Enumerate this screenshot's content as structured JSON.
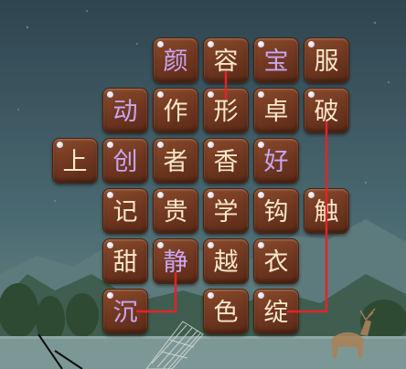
{
  "colors": {
    "purple_text": "#c8a6f2",
    "cream_text": "#f8e7c8",
    "link_line": "#e0242a",
    "tile_fill": "#6e3620"
  },
  "tiles": [
    {
      "id": "t-yan",
      "char": "颜",
      "row": 0,
      "col": 2,
      "color": "purple_text"
    },
    {
      "id": "t-rong",
      "char": "容",
      "row": 0,
      "col": 3,
      "color": "cream_text"
    },
    {
      "id": "t-bao",
      "char": "宝",
      "row": 0,
      "col": 4,
      "color": "purple_text"
    },
    {
      "id": "t-fu",
      "char": "服",
      "row": 0,
      "col": 5,
      "color": "cream_text"
    },
    {
      "id": "t-dong",
      "char": "动",
      "row": 1,
      "col": 1,
      "color": "purple_text"
    },
    {
      "id": "t-zuo",
      "char": "作",
      "row": 1,
      "col": 2,
      "color": "cream_text"
    },
    {
      "id": "t-xing",
      "char": "形",
      "row": 1,
      "col": 3,
      "color": "cream_text"
    },
    {
      "id": "t-zhuo",
      "char": "卓",
      "row": 1,
      "col": 4,
      "color": "cream_text"
    },
    {
      "id": "t-po",
      "char": "破",
      "row": 1,
      "col": 5,
      "color": "cream_text"
    },
    {
      "id": "t-shang",
      "char": "上",
      "row": 2,
      "col": 0,
      "color": "cream_text"
    },
    {
      "id": "t-chuang",
      "char": "创",
      "row": 2,
      "col": 1,
      "color": "purple_text"
    },
    {
      "id": "t-zhe",
      "char": "者",
      "row": 2,
      "col": 2,
      "color": "cream_text"
    },
    {
      "id": "t-xiang",
      "char": "香",
      "row": 2,
      "col": 3,
      "color": "cream_text"
    },
    {
      "id": "t-hao",
      "char": "好",
      "row": 2,
      "col": 4,
      "color": "purple_text"
    },
    {
      "id": "t-ji",
      "char": "记",
      "row": 3,
      "col": 1,
      "color": "cream_text"
    },
    {
      "id": "t-gui",
      "char": "贵",
      "row": 3,
      "col": 2,
      "color": "cream_text"
    },
    {
      "id": "t-xue",
      "char": "学",
      "row": 3,
      "col": 3,
      "color": "cream_text"
    },
    {
      "id": "t-gou",
      "char": "钩",
      "row": 3,
      "col": 4,
      "color": "cream_text"
    },
    {
      "id": "t-chu",
      "char": "触",
      "row": 3,
      "col": 5,
      "color": "cream_text"
    },
    {
      "id": "t-tian",
      "char": "甜",
      "row": 4,
      "col": 1,
      "color": "cream_text"
    },
    {
      "id": "t-jing",
      "char": "静",
      "row": 4,
      "col": 2,
      "color": "purple_text"
    },
    {
      "id": "t-yue",
      "char": "越",
      "row": 4,
      "col": 3,
      "color": "cream_text"
    },
    {
      "id": "t-yi",
      "char": "衣",
      "row": 4,
      "col": 4,
      "color": "cream_text"
    },
    {
      "id": "t-chen",
      "char": "沉",
      "row": 5,
      "col": 1,
      "color": "purple_text"
    },
    {
      "id": "t-se",
      "char": "色",
      "row": 5,
      "col": 3,
      "color": "cream_text"
    },
    {
      "id": "t-zhan",
      "char": "绽",
      "row": 5,
      "col": 4,
      "color": "cream_text"
    }
  ],
  "links": [
    {
      "from": "t-rong",
      "to": "t-xing"
    },
    {
      "from": "t-jing",
      "to": "t-chen"
    },
    {
      "from": "t-po",
      "to": "t-zhan"
    }
  ]
}
